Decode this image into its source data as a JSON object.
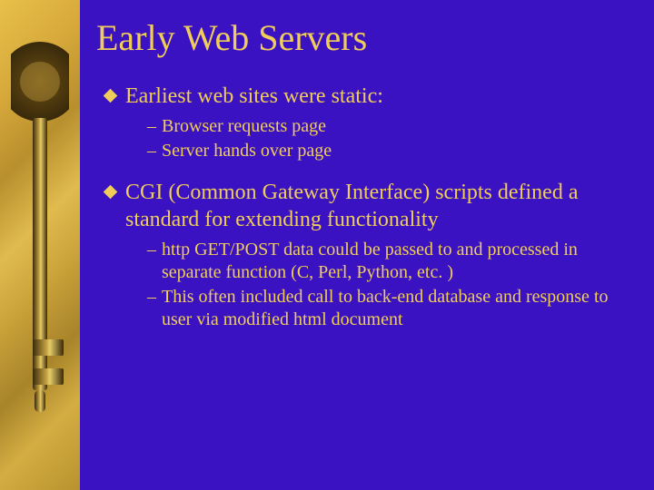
{
  "slide": {
    "title": "Early Web Servers",
    "bullets": [
      {
        "text": "Earliest web sites were static:",
        "sub": [
          "Browser requests page",
          "Server hands over page"
        ]
      },
      {
        "text": "CGI (Common Gateway Interface) scripts defined a standard for extending functionality",
        "sub": [
          "http GET/POST data could be passed to and processed in separate function (C, Perl, Python, etc. )",
          "This often included call to back-end database and response to user via modified html document"
        ]
      }
    ]
  }
}
